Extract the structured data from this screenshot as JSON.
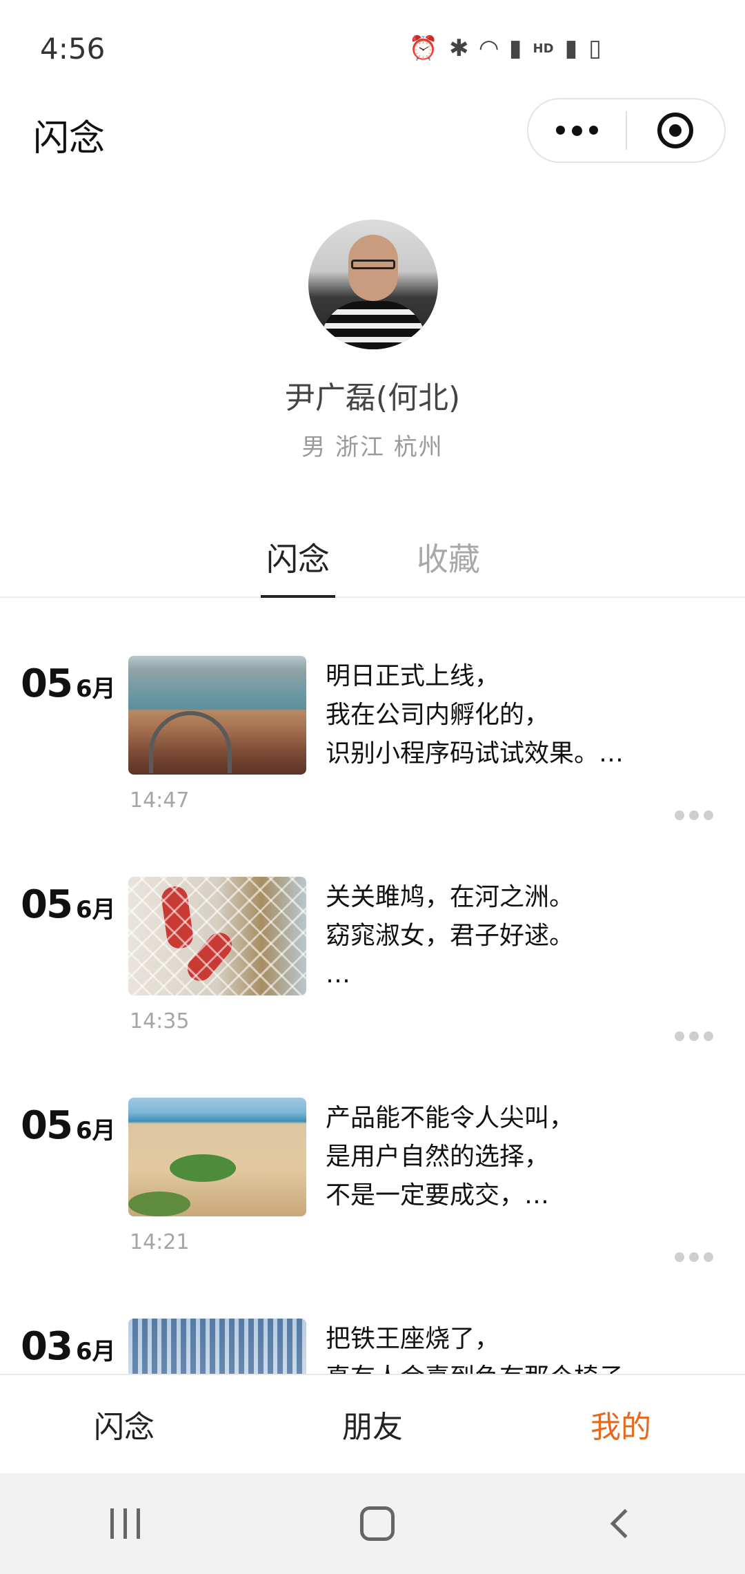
{
  "status_bar": {
    "time": "4:56",
    "icons": [
      "alarm-icon",
      "bluetooth-icon",
      "wifi-icon",
      "signal-4g-icon",
      "hd-icon",
      "signal-4g-icon",
      "battery-charging-icon"
    ]
  },
  "header": {
    "title": "闪念"
  },
  "profile": {
    "name": "尹广磊(何北)",
    "meta": "男 浙江 杭州"
  },
  "tabs": [
    {
      "label": "闪念",
      "active": true
    },
    {
      "label": "收藏",
      "active": false
    }
  ],
  "posts": [
    {
      "day": "05",
      "month": "6月",
      "text": "明日正式上线，\n我在公司内孵化的，\n识别小程序码试试效果。…",
      "time": "14:47"
    },
    {
      "day": "05",
      "month": "6月",
      "text": "关关雎鸠，在河之洲。\n窈窕淑女，君子好逑。\n…",
      "time": "14:35"
    },
    {
      "day": "05",
      "month": "6月",
      "text": "产品能不能令人尖叫，\n是用户自然的选择，\n不是一定要成交，…",
      "time": "14:21"
    },
    {
      "day": "03",
      "month": "6月",
      "text": "把铁王座烧了，\n真有人会喜到负有那个椅子",
      "time": ""
    }
  ],
  "bottom_nav": [
    {
      "label": "闪念",
      "active": false
    },
    {
      "label": "朋友",
      "active": false
    },
    {
      "label": "我的",
      "active": true
    }
  ],
  "colors": {
    "accent": "#e46a1e",
    "muted": "#a5a5a5"
  }
}
